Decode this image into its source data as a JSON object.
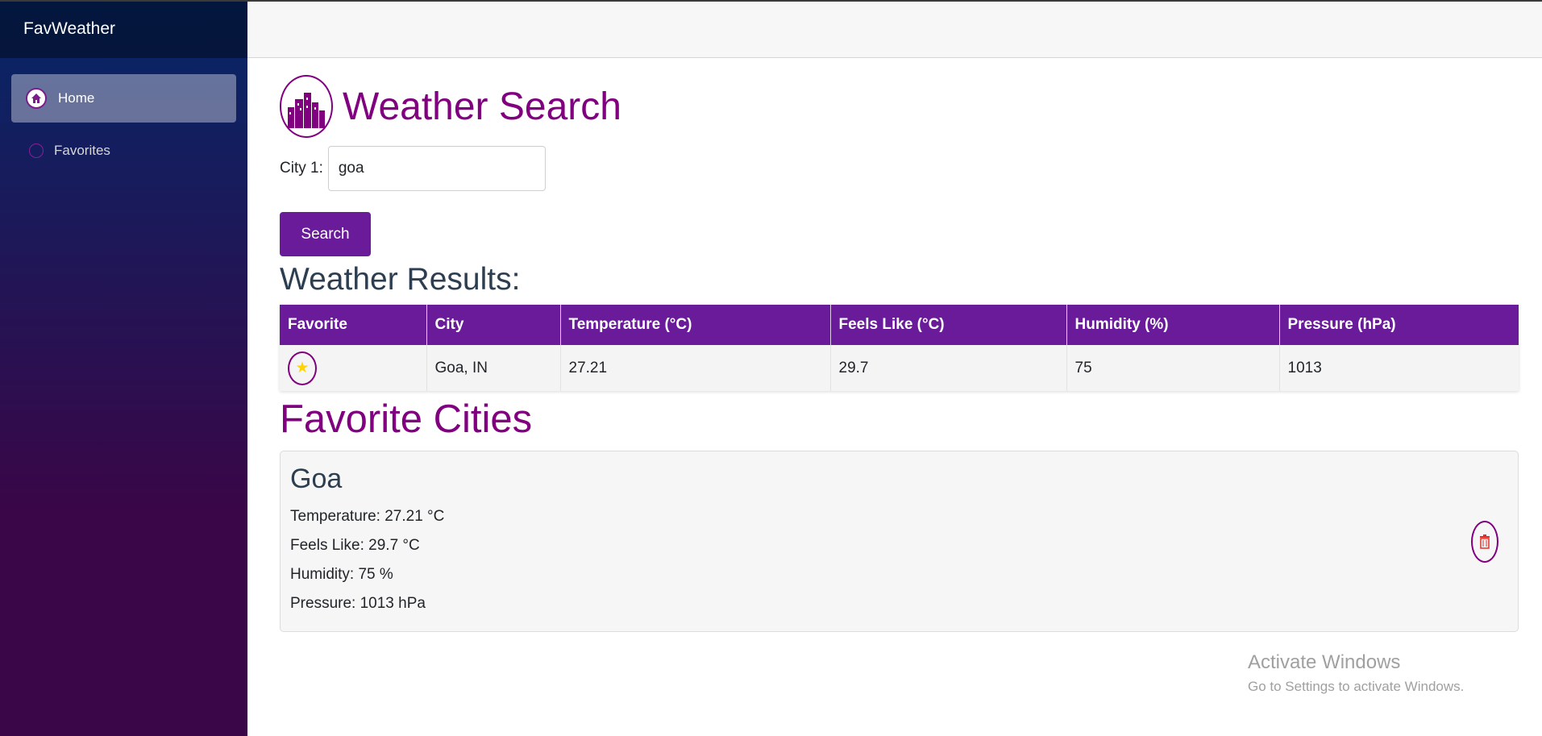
{
  "app": {
    "brand": "FavWeather"
  },
  "sidebar": {
    "items": [
      {
        "label": "Home",
        "icon": "home-icon",
        "active": true
      },
      {
        "label": "Favorites",
        "icon": "circle-icon",
        "active": false
      }
    ]
  },
  "search": {
    "title": "Weather Search",
    "logo_icon": "city-skyline-icon",
    "city_label": "City 1:",
    "city_value": "goa",
    "button_label": "Search"
  },
  "results": {
    "title": "Weather Results:",
    "headers": [
      "Favorite",
      "City",
      "Temperature (°C)",
      "Feels Like (°C)",
      "Humidity (%)",
      "Pressure (hPa)"
    ],
    "rows": [
      {
        "favorite_icon": "star-icon",
        "city": "Goa, IN",
        "temperature": "27.21",
        "feels_like": "29.7",
        "humidity": "75",
        "pressure": "1013"
      }
    ]
  },
  "favorites": {
    "title": "Favorite Cities",
    "cards": [
      {
        "city": "Goa",
        "temperature": "Temperature: 27.21 °C",
        "feels_like": "Feels Like: 29.7 °C",
        "humidity": "Humidity: 75 %",
        "pressure": "Pressure: 1013 hPa",
        "delete_icon": "trash-icon"
      }
    ]
  },
  "watermark": {
    "title": "Activate Windows",
    "subtitle": "Go to Settings to activate Windows."
  },
  "colors": {
    "primary": "#6a1b9a",
    "heading": "#800080",
    "star": "#ffd400",
    "trash": "#e0302a"
  }
}
